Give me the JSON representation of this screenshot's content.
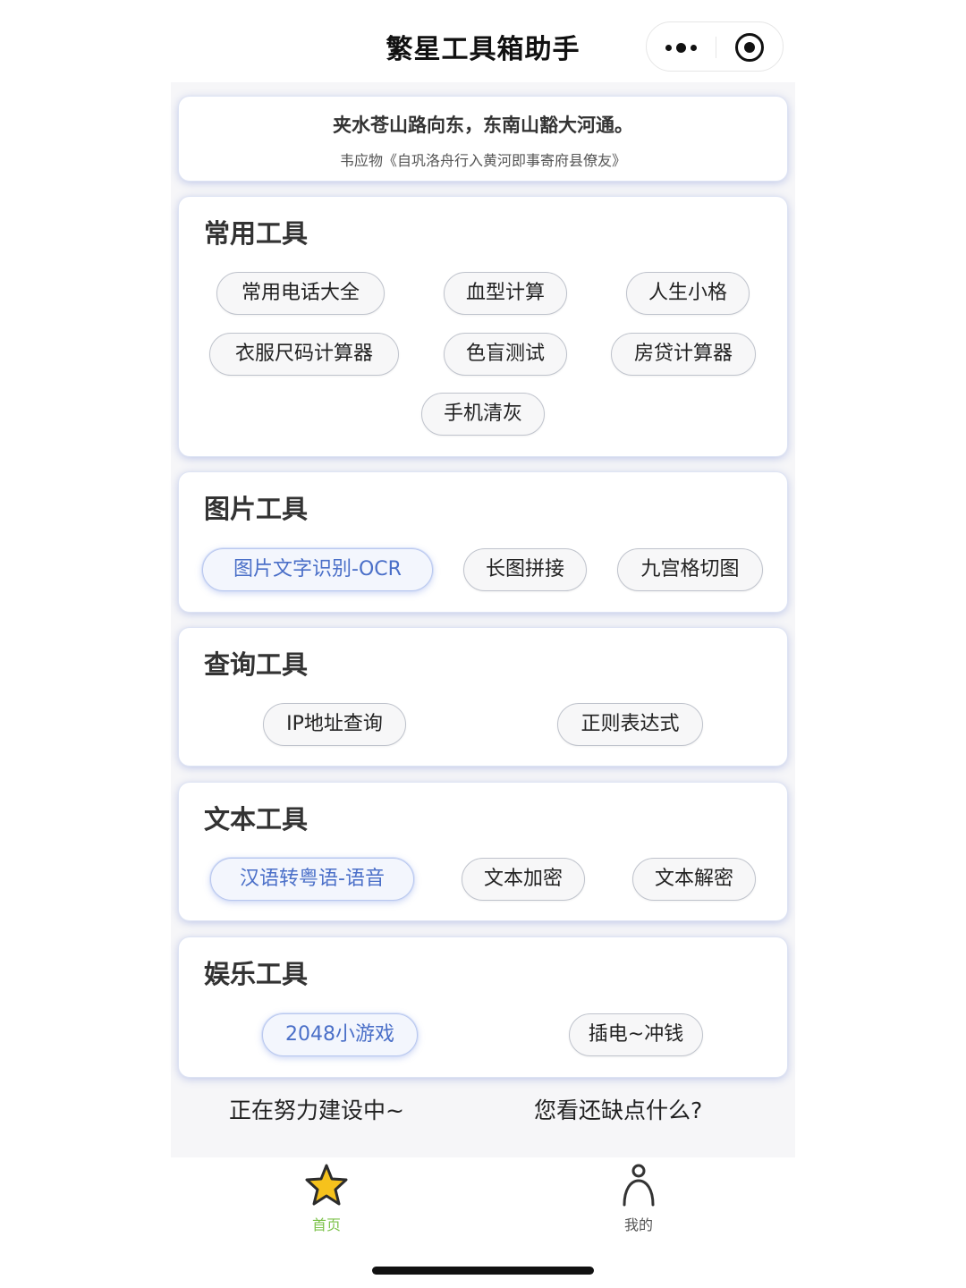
{
  "app": {
    "title": "繁星工具箱助手"
  },
  "quote": {
    "text": "夹水苍山路向东，东南山豁大河通。",
    "source": "韦应物《自巩洛舟行入黄河即事寄府县僚友》"
  },
  "sections": {
    "common": {
      "title": "常用工具",
      "items": [
        "常用电话大全",
        "血型计算",
        "人生小格",
        "衣服尺码计算器",
        "色盲测试",
        "房贷计算器",
        "手机清灰"
      ]
    },
    "image": {
      "title": "图片工具",
      "items": [
        "图片文字识别-OCR",
        "长图拼接",
        "九宫格切图"
      ]
    },
    "query": {
      "title": "查询工具",
      "items": [
        "IP地址查询",
        "正则表达式"
      ]
    },
    "text": {
      "title": "文本工具",
      "items": [
        "汉语转粤语-语音",
        "文本加密",
        "文本解密"
      ]
    },
    "fun": {
      "title": "娱乐工具",
      "items": [
        "2048小游戏",
        "插电~冲钱"
      ]
    }
  },
  "footer": {
    "left": "正在努力建设中~",
    "right": "您看还缺点什么?"
  },
  "tabbar": {
    "home": {
      "label": "首页",
      "icon": "star-icon",
      "active_color": "#7cc24a"
    },
    "mine": {
      "label": "我的",
      "icon": "person-icon",
      "color": "#555555"
    }
  },
  "colors": {
    "accent": "#4a6fc8",
    "card_glow": "#8ea2e0",
    "star_fill": "#f6c21c"
  }
}
